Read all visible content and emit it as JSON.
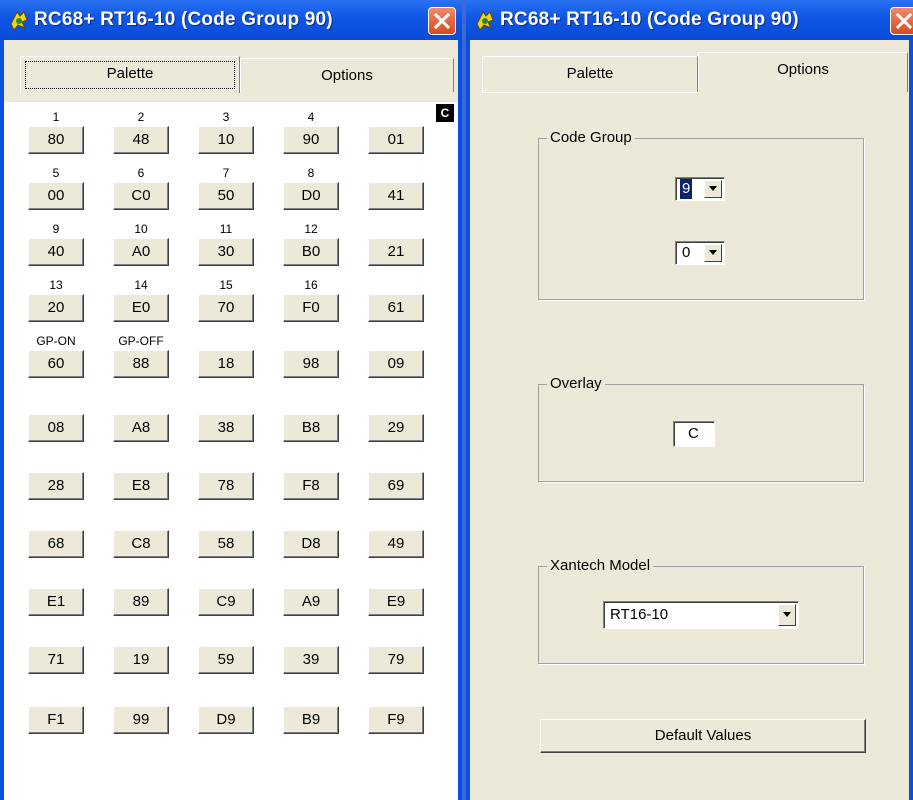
{
  "left_window": {
    "title": "RC68+ RT16-10 (Code Group 90)",
    "tabs": [
      {
        "label": "Palette",
        "selected": true
      },
      {
        "label": "Options",
        "selected": false
      }
    ],
    "overlay_badge": "C",
    "palette_rows": [
      [
        {
          "label": "1",
          "code": "80"
        },
        {
          "label": "2",
          "code": "48"
        },
        {
          "label": "3",
          "code": "10"
        },
        {
          "label": "4",
          "code": "90"
        },
        {
          "label": "",
          "code": "01"
        }
      ],
      [
        {
          "label": "5",
          "code": "00"
        },
        {
          "label": "6",
          "code": "C0"
        },
        {
          "label": "7",
          "code": "50"
        },
        {
          "label": "8",
          "code": "D0"
        },
        {
          "label": "",
          "code": "41"
        }
      ],
      [
        {
          "label": "9",
          "code": "40"
        },
        {
          "label": "10",
          "code": "A0"
        },
        {
          "label": "11",
          "code": "30"
        },
        {
          "label": "12",
          "code": "B0"
        },
        {
          "label": "",
          "code": "21"
        }
      ],
      [
        {
          "label": "13",
          "code": "20"
        },
        {
          "label": "14",
          "code": "E0"
        },
        {
          "label": "15",
          "code": "70"
        },
        {
          "label": "16",
          "code": "F0"
        },
        {
          "label": "",
          "code": "61"
        }
      ],
      [
        {
          "label": "GP-ON",
          "code": "60"
        },
        {
          "label": "GP-OFF",
          "code": "88"
        },
        {
          "label": "",
          "code": "18"
        },
        {
          "label": "",
          "code": "98"
        },
        {
          "label": "",
          "code": "09"
        }
      ],
      [
        {
          "label": "",
          "code": "08"
        },
        {
          "label": "",
          "code": "A8"
        },
        {
          "label": "",
          "code": "38"
        },
        {
          "label": "",
          "code": "B8"
        },
        {
          "label": "",
          "code": "29"
        }
      ],
      [
        {
          "label": "",
          "code": "28"
        },
        {
          "label": "",
          "code": "E8"
        },
        {
          "label": "",
          "code": "78"
        },
        {
          "label": "",
          "code": "F8"
        },
        {
          "label": "",
          "code": "69"
        }
      ],
      [
        {
          "label": "",
          "code": "68"
        },
        {
          "label": "",
          "code": "C8"
        },
        {
          "label": "",
          "code": "58"
        },
        {
          "label": "",
          "code": "D8"
        },
        {
          "label": "",
          "code": "49"
        }
      ],
      [
        {
          "label": "",
          "code": "E1"
        },
        {
          "label": "",
          "code": "89"
        },
        {
          "label": "",
          "code": "C9"
        },
        {
          "label": "",
          "code": "A9"
        },
        {
          "label": "",
          "code": "E9"
        }
      ],
      [
        {
          "label": "",
          "code": "71"
        },
        {
          "label": "",
          "code": "19"
        },
        {
          "label": "",
          "code": "59"
        },
        {
          "label": "",
          "code": "39"
        },
        {
          "label": "",
          "code": "79"
        }
      ],
      [
        {
          "label": "",
          "code": "F1"
        },
        {
          "label": "",
          "code": "99"
        },
        {
          "label": "",
          "code": "D9"
        },
        {
          "label": "",
          "code": "B9"
        },
        {
          "label": "",
          "code": "F9"
        }
      ]
    ]
  },
  "right_window": {
    "title": "RC68+ RT16-10 (Code Group 90)",
    "tabs": [
      {
        "label": "Palette",
        "selected": false
      },
      {
        "label": "Options",
        "selected": true
      }
    ],
    "code_group": {
      "title": "Code Group",
      "first_digit": "9",
      "second_digit": "0"
    },
    "overlay": {
      "title": "Overlay",
      "value": "C"
    },
    "xantech_model": {
      "title": "Xantech Model",
      "value": "RT16-10"
    },
    "default_button": "Default Values"
  },
  "colors": {
    "titlebar": "#0a50e0",
    "dialog_face": "#ece9d8",
    "close_button": "#d84a1e"
  },
  "icons": [
    "app-icon",
    "close-icon",
    "dropdown-arrow-icon"
  ]
}
